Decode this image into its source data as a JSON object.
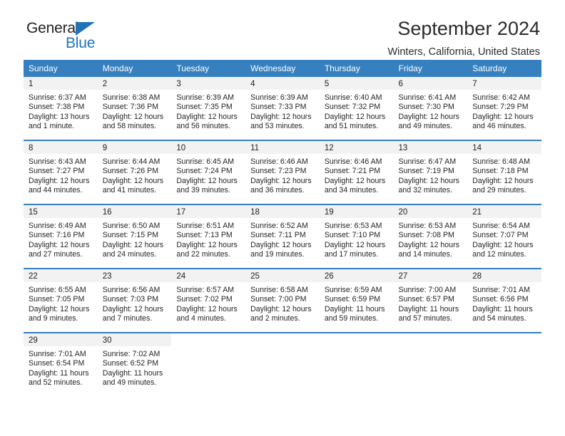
{
  "brand": {
    "name_part1": "General",
    "name_part2": "Blue",
    "accent_color": "#1f73b8"
  },
  "header": {
    "title": "September 2024",
    "subtitle": "Winters, California, United States"
  },
  "theme": {
    "header_row_color": "#3680bf",
    "daynum_band_color": "#f2f2f2",
    "text_color": "#252525"
  },
  "weekday_headers": [
    "Sunday",
    "Monday",
    "Tuesday",
    "Wednesday",
    "Thursday",
    "Friday",
    "Saturday"
  ],
  "weeks": [
    {
      "days": [
        {
          "date": "1",
          "sunrise": "Sunrise: 6:37 AM",
          "sunset": "Sunset: 7:38 PM",
          "daylight_line1": "Daylight: 13 hours",
          "daylight_line2": "and 1 minute."
        },
        {
          "date": "2",
          "sunrise": "Sunrise: 6:38 AM",
          "sunset": "Sunset: 7:36 PM",
          "daylight_line1": "Daylight: 12 hours",
          "daylight_line2": "and 58 minutes."
        },
        {
          "date": "3",
          "sunrise": "Sunrise: 6:39 AM",
          "sunset": "Sunset: 7:35 PM",
          "daylight_line1": "Daylight: 12 hours",
          "daylight_line2": "and 56 minutes."
        },
        {
          "date": "4",
          "sunrise": "Sunrise: 6:39 AM",
          "sunset": "Sunset: 7:33 PM",
          "daylight_line1": "Daylight: 12 hours",
          "daylight_line2": "and 53 minutes."
        },
        {
          "date": "5",
          "sunrise": "Sunrise: 6:40 AM",
          "sunset": "Sunset: 7:32 PM",
          "daylight_line1": "Daylight: 12 hours",
          "daylight_line2": "and 51 minutes."
        },
        {
          "date": "6",
          "sunrise": "Sunrise: 6:41 AM",
          "sunset": "Sunset: 7:30 PM",
          "daylight_line1": "Daylight: 12 hours",
          "daylight_line2": "and 49 minutes."
        },
        {
          "date": "7",
          "sunrise": "Sunrise: 6:42 AM",
          "sunset": "Sunset: 7:29 PM",
          "daylight_line1": "Daylight: 12 hours",
          "daylight_line2": "and 46 minutes."
        }
      ]
    },
    {
      "days": [
        {
          "date": "8",
          "sunrise": "Sunrise: 6:43 AM",
          "sunset": "Sunset: 7:27 PM",
          "daylight_line1": "Daylight: 12 hours",
          "daylight_line2": "and 44 minutes."
        },
        {
          "date": "9",
          "sunrise": "Sunrise: 6:44 AM",
          "sunset": "Sunset: 7:26 PM",
          "daylight_line1": "Daylight: 12 hours",
          "daylight_line2": "and 41 minutes."
        },
        {
          "date": "10",
          "sunrise": "Sunrise: 6:45 AM",
          "sunset": "Sunset: 7:24 PM",
          "daylight_line1": "Daylight: 12 hours",
          "daylight_line2": "and 39 minutes."
        },
        {
          "date": "11",
          "sunrise": "Sunrise: 6:46 AM",
          "sunset": "Sunset: 7:23 PM",
          "daylight_line1": "Daylight: 12 hours",
          "daylight_line2": "and 36 minutes."
        },
        {
          "date": "12",
          "sunrise": "Sunrise: 6:46 AM",
          "sunset": "Sunset: 7:21 PM",
          "daylight_line1": "Daylight: 12 hours",
          "daylight_line2": "and 34 minutes."
        },
        {
          "date": "13",
          "sunrise": "Sunrise: 6:47 AM",
          "sunset": "Sunset: 7:19 PM",
          "daylight_line1": "Daylight: 12 hours",
          "daylight_line2": "and 32 minutes."
        },
        {
          "date": "14",
          "sunrise": "Sunrise: 6:48 AM",
          "sunset": "Sunset: 7:18 PM",
          "daylight_line1": "Daylight: 12 hours",
          "daylight_line2": "and 29 minutes."
        }
      ]
    },
    {
      "days": [
        {
          "date": "15",
          "sunrise": "Sunrise: 6:49 AM",
          "sunset": "Sunset: 7:16 PM",
          "daylight_line1": "Daylight: 12 hours",
          "daylight_line2": "and 27 minutes."
        },
        {
          "date": "16",
          "sunrise": "Sunrise: 6:50 AM",
          "sunset": "Sunset: 7:15 PM",
          "daylight_line1": "Daylight: 12 hours",
          "daylight_line2": "and 24 minutes."
        },
        {
          "date": "17",
          "sunrise": "Sunrise: 6:51 AM",
          "sunset": "Sunset: 7:13 PM",
          "daylight_line1": "Daylight: 12 hours",
          "daylight_line2": "and 22 minutes."
        },
        {
          "date": "18",
          "sunrise": "Sunrise: 6:52 AM",
          "sunset": "Sunset: 7:11 PM",
          "daylight_line1": "Daylight: 12 hours",
          "daylight_line2": "and 19 minutes."
        },
        {
          "date": "19",
          "sunrise": "Sunrise: 6:53 AM",
          "sunset": "Sunset: 7:10 PM",
          "daylight_line1": "Daylight: 12 hours",
          "daylight_line2": "and 17 minutes."
        },
        {
          "date": "20",
          "sunrise": "Sunrise: 6:53 AM",
          "sunset": "Sunset: 7:08 PM",
          "daylight_line1": "Daylight: 12 hours",
          "daylight_line2": "and 14 minutes."
        },
        {
          "date": "21",
          "sunrise": "Sunrise: 6:54 AM",
          "sunset": "Sunset: 7:07 PM",
          "daylight_line1": "Daylight: 12 hours",
          "daylight_line2": "and 12 minutes."
        }
      ]
    },
    {
      "days": [
        {
          "date": "22",
          "sunrise": "Sunrise: 6:55 AM",
          "sunset": "Sunset: 7:05 PM",
          "daylight_line1": "Daylight: 12 hours",
          "daylight_line2": "and 9 minutes."
        },
        {
          "date": "23",
          "sunrise": "Sunrise: 6:56 AM",
          "sunset": "Sunset: 7:03 PM",
          "daylight_line1": "Daylight: 12 hours",
          "daylight_line2": "and 7 minutes."
        },
        {
          "date": "24",
          "sunrise": "Sunrise: 6:57 AM",
          "sunset": "Sunset: 7:02 PM",
          "daylight_line1": "Daylight: 12 hours",
          "daylight_line2": "and 4 minutes."
        },
        {
          "date": "25",
          "sunrise": "Sunrise: 6:58 AM",
          "sunset": "Sunset: 7:00 PM",
          "daylight_line1": "Daylight: 12 hours",
          "daylight_line2": "and 2 minutes."
        },
        {
          "date": "26",
          "sunrise": "Sunrise: 6:59 AM",
          "sunset": "Sunset: 6:59 PM",
          "daylight_line1": "Daylight: 11 hours",
          "daylight_line2": "and 59 minutes."
        },
        {
          "date": "27",
          "sunrise": "Sunrise: 7:00 AM",
          "sunset": "Sunset: 6:57 PM",
          "daylight_line1": "Daylight: 11 hours",
          "daylight_line2": "and 57 minutes."
        },
        {
          "date": "28",
          "sunrise": "Sunrise: 7:01 AM",
          "sunset": "Sunset: 6:56 PM",
          "daylight_line1": "Daylight: 11 hours",
          "daylight_line2": "and 54 minutes."
        }
      ]
    },
    {
      "days": [
        {
          "date": "29",
          "sunrise": "Sunrise: 7:01 AM",
          "sunset": "Sunset: 6:54 PM",
          "daylight_line1": "Daylight: 11 hours",
          "daylight_line2": "and 52 minutes."
        },
        {
          "date": "30",
          "sunrise": "Sunrise: 7:02 AM",
          "sunset": "Sunset: 6:52 PM",
          "daylight_line1": "Daylight: 11 hours",
          "daylight_line2": "and 49 minutes."
        },
        {
          "date": "",
          "sunrise": "",
          "sunset": "",
          "daylight_line1": "",
          "daylight_line2": ""
        },
        {
          "date": "",
          "sunrise": "",
          "sunset": "",
          "daylight_line1": "",
          "daylight_line2": ""
        },
        {
          "date": "",
          "sunrise": "",
          "sunset": "",
          "daylight_line1": "",
          "daylight_line2": ""
        },
        {
          "date": "",
          "sunrise": "",
          "sunset": "",
          "daylight_line1": "",
          "daylight_line2": ""
        },
        {
          "date": "",
          "sunrise": "",
          "sunset": "",
          "daylight_line1": "",
          "daylight_line2": ""
        }
      ]
    }
  ]
}
